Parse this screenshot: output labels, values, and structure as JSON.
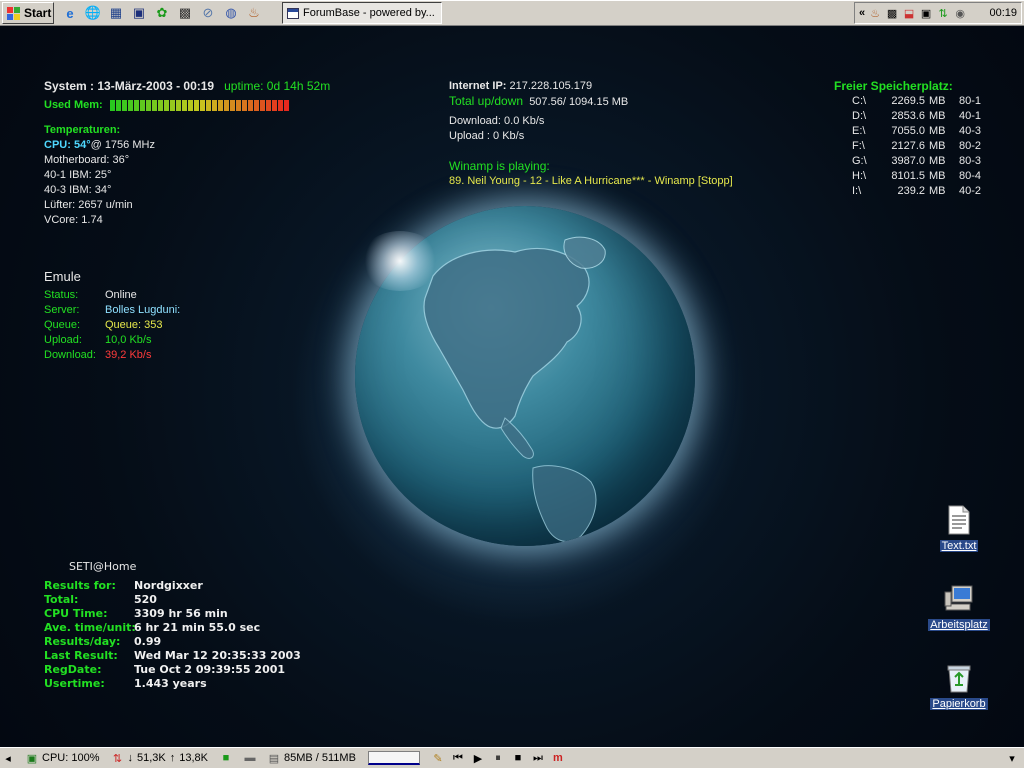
{
  "taskbar_top": {
    "start_label": "Start",
    "quicklaunch_icons": [
      "ie-icon",
      "ie-alt-icon",
      "explorer-icon",
      "floppy-icon",
      "clover-icon",
      "game-icon",
      "link-icon",
      "globe-icon",
      "media-icon"
    ],
    "task_button_label": "ForumBase - powered by...",
    "tray_chevron": "«",
    "clock": "00:19"
  },
  "system": {
    "label": "System",
    "datetime": ": 13-März-2003 - 00:19",
    "uptime": "uptime: 0d 14h 52m",
    "used_mem_label": "Used Mem:",
    "used_mem_fraction": 0.55,
    "temps_header": "Temperaturen:",
    "cpu_label": "CPU:",
    "cpu_temp": "54°",
    "cpu_speed": "@ 1756 MHz",
    "lines": [
      "Motherboard: 36°",
      "40-1 IBM: 25°",
      "40-3 IBM: 34°",
      "Lüfter: 2657 u/min",
      "VCore: 1.74"
    ]
  },
  "network": {
    "ip_label": "Internet IP:",
    "ip": "217.228.105.179",
    "total_label": "Total up/down",
    "total_value": "507.56/ 1094.15 MB",
    "download": "Download:  0.0 Kb/s",
    "upload": "Upload : 0 Kb/s"
  },
  "winamp": {
    "header": "Winamp is playing:",
    "track": "89. Neil Young - 12 - Like A Hurricane*** - Winamp [Stopp]"
  },
  "disks": {
    "header": "Freier Speicherplatz:",
    "rows": [
      {
        "drive": "C:\\",
        "value": "2269.5",
        "unit": "MB",
        "tag": "80-1"
      },
      {
        "drive": "D:\\",
        "value": "2853.6",
        "unit": "MB",
        "tag": "40-1"
      },
      {
        "drive": "E:\\",
        "value": "7055.0",
        "unit": "MB",
        "tag": "40-3"
      },
      {
        "drive": "F:\\",
        "value": "2127.6",
        "unit": "MB",
        "tag": "80-2"
      },
      {
        "drive": "G:\\",
        "value": "3987.0",
        "unit": "MB",
        "tag": "80-3"
      },
      {
        "drive": "H:\\",
        "value": "8101.5",
        "unit": "MB",
        "tag": "80-4"
      },
      {
        "drive": "I:\\",
        "value": "239.2",
        "unit": "MB",
        "tag": "40-2"
      }
    ]
  },
  "emule": {
    "title": "Emule",
    "rows": [
      {
        "key": "Status:",
        "value": "Online",
        "color": "#e8e8e8"
      },
      {
        "key": "Server:",
        "value": "Bolles Lugduni:",
        "color": "#8fe0ff"
      },
      {
        "key": "Queue:",
        "value": "Queue: 353",
        "color": "#e6e84c"
      },
      {
        "key": "Upload:",
        "value": "10,0 Kb/s",
        "color": "#22e022"
      },
      {
        "key": "Download:",
        "value": "39,2 Kb/s",
        "color": "#ff3b3b"
      }
    ]
  },
  "seti": {
    "title": "SETI@Home",
    "rows": [
      {
        "key": "Results for:",
        "value": "Nordgixxer"
      },
      {
        "key": "Total:",
        "value": "520"
      },
      {
        "key": "CPU Time:",
        "value": "3309 hr 56 min"
      },
      {
        "key": "Ave. time/unit:",
        "value": "6 hr 21 min 55.0 sec"
      },
      {
        "key": "Results/day:",
        "value": "0.99"
      },
      {
        "key": "Last Result:",
        "value": "Wed Mar 12 20:35:33 2003"
      },
      {
        "key": "RegDate:",
        "value": "Tue Oct  2 09:39:55 2001"
      },
      {
        "key": "Usertime:",
        "value": "1.443 years"
      }
    ]
  },
  "desktop_icons": [
    {
      "label": "Text.txt",
      "icon": "text-file-icon"
    },
    {
      "label": "Arbeitsplatz",
      "icon": "my-computer-icon"
    },
    {
      "label": "Papierkorb",
      "icon": "recycle-bin-icon"
    }
  ],
  "taskbar_bottom": {
    "cpu": "CPU: 100%",
    "down": "51,3K",
    "up": "13,8K",
    "mem": "85MB / 511MB"
  }
}
